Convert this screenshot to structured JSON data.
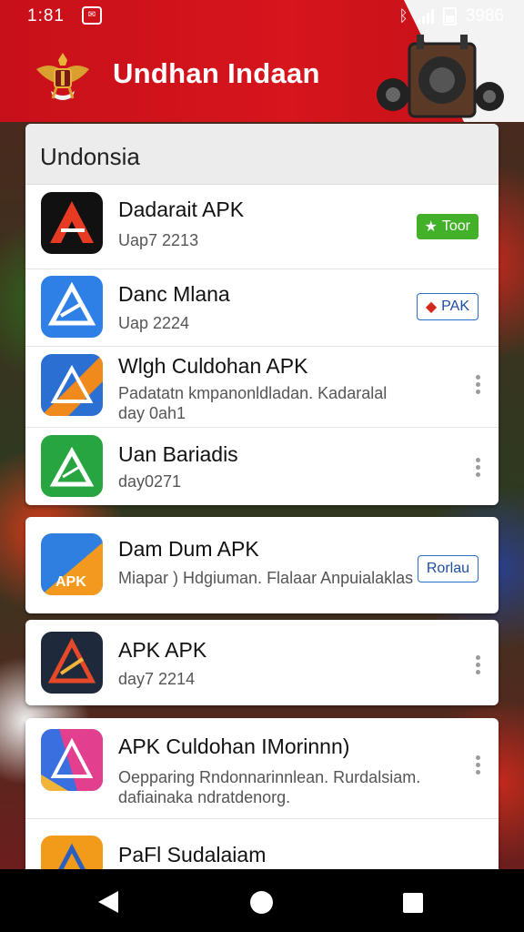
{
  "status_bar": {
    "time": "1:81",
    "notif_glyph": "✉",
    "battery": "3986"
  },
  "header": {
    "title": "Undhan Indaan"
  },
  "section1": {
    "title": "Undonsia",
    "items": [
      {
        "name": "Dadarait APK",
        "sub": "Uap7 2213",
        "badge": "Toor",
        "icon_colors": [
          "#111111",
          "#e63a23"
        ]
      },
      {
        "name": "Danc Mlana",
        "sub": "Uap 2224",
        "badge": "PAK",
        "icon_colors": [
          "#2f80e6",
          "#ffffff"
        ]
      },
      {
        "name": "Wlgh Culdohan APK",
        "sub": "Padatatn kmpanonldladan. Kadaralal",
        "sub2": "day 0ah1",
        "icon_colors": [
          "#2a6fd1",
          "#f08a1c"
        ]
      },
      {
        "name": "Uan Bariadis",
        "sub": "day0271",
        "icon_colors": [
          "#26a541",
          "#ffffff"
        ]
      }
    ]
  },
  "section2": {
    "items": [
      {
        "name": "Dam Dum APK",
        "sub": "Miapar ) Hdgiuman. Flalaar Anpuialaklas",
        "badge": "Rorlau",
        "icon_colors": [
          "#2f7fe0",
          "#f39a1e"
        ]
      }
    ]
  },
  "section3": {
    "items": [
      {
        "name": "APK APK",
        "sub": "day7 2214",
        "icon_colors": [
          "#1e2a3c",
          "#e5492a"
        ]
      }
    ]
  },
  "section4": {
    "items": [
      {
        "name": "APK Culdohan IMorinnn)",
        "sub": "Oepparing Rndonnarinnlean. Rurdalsiam.",
        "sub2": "dafiainaka ndratdenorg.",
        "icon_colors": [
          "#3a6fe0",
          "#e23f8e"
        ]
      },
      {
        "name": "PaFl Sudalaiam",
        "sub": "",
        "icon_colors": [
          "#f29a1a",
          "#ffffff"
        ]
      }
    ]
  },
  "colors": {
    "header_red": "#d6151c",
    "badge_green": "#43b02a",
    "accent_blue": "#2a6fc9"
  }
}
